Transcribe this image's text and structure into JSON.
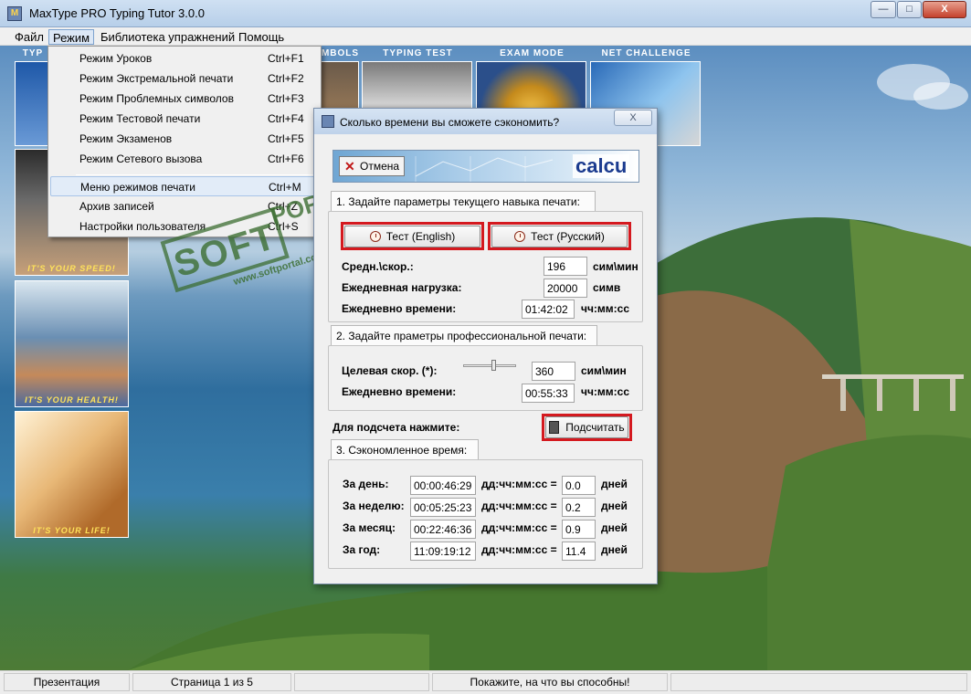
{
  "window": {
    "title": "MaxType PRO Typing Tutor 3.0.0",
    "controls": {
      "minimize": "—",
      "maximize": "□",
      "close": "X"
    }
  },
  "menubar": {
    "items": [
      "Файл",
      "Режим",
      "Библиотека упражнений",
      "Помощь"
    ],
    "active": "Режим"
  },
  "mode_tabs": [
    "TYP",
    "MBOLS",
    "TYPING TEST",
    "EXAM MODE",
    "NET CHALLENGE"
  ],
  "side_panels": [
    {
      "caption": ""
    },
    {
      "caption": "IT'S YOUR SPEED!"
    },
    {
      "caption": "IT'S YOUR HEALTH!"
    },
    {
      "caption": "IT'S YOUR LIFE!"
    }
  ],
  "mode_menu": {
    "items": [
      {
        "label": "Режим Уроков",
        "shortcut": "Ctrl+F1"
      },
      {
        "label": "Режим Экстремальной печати",
        "shortcut": "Ctrl+F2"
      },
      {
        "label": "Режим Проблемных символов",
        "shortcut": "Ctrl+F3"
      },
      {
        "label": "Режим Тестовой печати",
        "shortcut": "Ctrl+F4"
      },
      {
        "label": "Режим Экзаменов",
        "shortcut": "Ctrl+F5"
      },
      {
        "label": "Режим Сетевого вызова",
        "shortcut": "Ctrl+F6"
      },
      {
        "label": "Меню режимов печати",
        "shortcut": "Ctrl+M"
      },
      {
        "label": "Архив записей",
        "shortcut": "Ctrl+Z"
      },
      {
        "label": "Настройки пользователя",
        "shortcut": "Ctrl+S"
      }
    ],
    "highlighted": "Меню режимов печати"
  },
  "watermark": {
    "soft": "SOFT",
    "portal": "PORTAL",
    "url": "www.softportal.com"
  },
  "dialog": {
    "title": "Сколько времени вы сможете сэкономить?",
    "close": "X",
    "cancel_label": "Отмена",
    "banner_word": "calcu",
    "section1": {
      "tab": "1. Задайте параметры текущего навыка печати:",
      "test_en": "Тест (English)",
      "test_ru": "Тест (Русский)",
      "rows": [
        {
          "label": "Средн.\\скор.:",
          "value": "196",
          "unit": "сим\\мин"
        },
        {
          "label": "Ежедневная нагрузка:",
          "value": "20000",
          "unit": "симв"
        },
        {
          "label": "Ежедневно времени:",
          "value": "01:42:02",
          "unit": "чч:мм:сс"
        }
      ]
    },
    "section2": {
      "tab": "2. Задайте праметры профессиональной печати:",
      "rows": [
        {
          "label": "Целевая скор. (*):",
          "value": "360",
          "unit": "сим\\мин"
        },
        {
          "label": "Ежедневно времени:",
          "value": "00:55:33",
          "unit": "чч:мм:сс"
        }
      ],
      "slider_level": 0.62
    },
    "calc_prompt": "Для подсчета нажмите:",
    "calc_button": "Подсчитать",
    "section3": {
      "tab": "3. Сэкономленное время:",
      "format_label": "дд:чч:мм:сс =",
      "unit": "дней",
      "rows": [
        {
          "label": "За день:",
          "time": "00:00:46:29",
          "days": "0.0"
        },
        {
          "label": "За неделю:",
          "time": "00:05:25:23",
          "days": "0.2"
        },
        {
          "label": "За месяц:",
          "time": "00:22:46:36",
          "days": "0.9"
        },
        {
          "label": "За год:",
          "time": "11:09:19:12",
          "days": "11.4"
        }
      ]
    }
  },
  "statusbar": {
    "cells": [
      "Презентация",
      "Страница 1 из 5",
      "Покажите, на что вы способны!"
    ]
  },
  "colors": {
    "highlight_frame": "#d4191f",
    "title_bar": "#bfd2ea",
    "menu_highlight": "#e2ecf8"
  }
}
